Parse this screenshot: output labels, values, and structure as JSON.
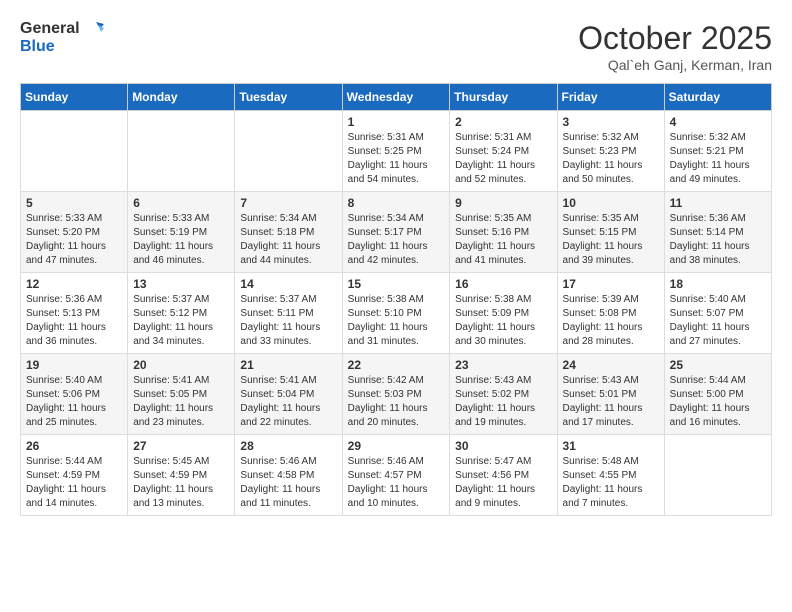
{
  "logo": {
    "general": "General",
    "blue": "Blue"
  },
  "header": {
    "month_year": "October 2025",
    "location": "Qal`eh Ganj, Kerman, Iran"
  },
  "weekdays": [
    "Sunday",
    "Monday",
    "Tuesday",
    "Wednesday",
    "Thursday",
    "Friday",
    "Saturday"
  ],
  "weeks": [
    [
      {
        "day": "",
        "detail": ""
      },
      {
        "day": "",
        "detail": ""
      },
      {
        "day": "",
        "detail": ""
      },
      {
        "day": "1",
        "detail": "Sunrise: 5:31 AM\nSunset: 5:25 PM\nDaylight: 11 hours\nand 54 minutes."
      },
      {
        "day": "2",
        "detail": "Sunrise: 5:31 AM\nSunset: 5:24 PM\nDaylight: 11 hours\nand 52 minutes."
      },
      {
        "day": "3",
        "detail": "Sunrise: 5:32 AM\nSunset: 5:23 PM\nDaylight: 11 hours\nand 50 minutes."
      },
      {
        "day": "4",
        "detail": "Sunrise: 5:32 AM\nSunset: 5:21 PM\nDaylight: 11 hours\nand 49 minutes."
      }
    ],
    [
      {
        "day": "5",
        "detail": "Sunrise: 5:33 AM\nSunset: 5:20 PM\nDaylight: 11 hours\nand 47 minutes."
      },
      {
        "day": "6",
        "detail": "Sunrise: 5:33 AM\nSunset: 5:19 PM\nDaylight: 11 hours\nand 46 minutes."
      },
      {
        "day": "7",
        "detail": "Sunrise: 5:34 AM\nSunset: 5:18 PM\nDaylight: 11 hours\nand 44 minutes."
      },
      {
        "day": "8",
        "detail": "Sunrise: 5:34 AM\nSunset: 5:17 PM\nDaylight: 11 hours\nand 42 minutes."
      },
      {
        "day": "9",
        "detail": "Sunrise: 5:35 AM\nSunset: 5:16 PM\nDaylight: 11 hours\nand 41 minutes."
      },
      {
        "day": "10",
        "detail": "Sunrise: 5:35 AM\nSunset: 5:15 PM\nDaylight: 11 hours\nand 39 minutes."
      },
      {
        "day": "11",
        "detail": "Sunrise: 5:36 AM\nSunset: 5:14 PM\nDaylight: 11 hours\nand 38 minutes."
      }
    ],
    [
      {
        "day": "12",
        "detail": "Sunrise: 5:36 AM\nSunset: 5:13 PM\nDaylight: 11 hours\nand 36 minutes."
      },
      {
        "day": "13",
        "detail": "Sunrise: 5:37 AM\nSunset: 5:12 PM\nDaylight: 11 hours\nand 34 minutes."
      },
      {
        "day": "14",
        "detail": "Sunrise: 5:37 AM\nSunset: 5:11 PM\nDaylight: 11 hours\nand 33 minutes."
      },
      {
        "day": "15",
        "detail": "Sunrise: 5:38 AM\nSunset: 5:10 PM\nDaylight: 11 hours\nand 31 minutes."
      },
      {
        "day": "16",
        "detail": "Sunrise: 5:38 AM\nSunset: 5:09 PM\nDaylight: 11 hours\nand 30 minutes."
      },
      {
        "day": "17",
        "detail": "Sunrise: 5:39 AM\nSunset: 5:08 PM\nDaylight: 11 hours\nand 28 minutes."
      },
      {
        "day": "18",
        "detail": "Sunrise: 5:40 AM\nSunset: 5:07 PM\nDaylight: 11 hours\nand 27 minutes."
      }
    ],
    [
      {
        "day": "19",
        "detail": "Sunrise: 5:40 AM\nSunset: 5:06 PM\nDaylight: 11 hours\nand 25 minutes."
      },
      {
        "day": "20",
        "detail": "Sunrise: 5:41 AM\nSunset: 5:05 PM\nDaylight: 11 hours\nand 23 minutes."
      },
      {
        "day": "21",
        "detail": "Sunrise: 5:41 AM\nSunset: 5:04 PM\nDaylight: 11 hours\nand 22 minutes."
      },
      {
        "day": "22",
        "detail": "Sunrise: 5:42 AM\nSunset: 5:03 PM\nDaylight: 11 hours\nand 20 minutes."
      },
      {
        "day": "23",
        "detail": "Sunrise: 5:43 AM\nSunset: 5:02 PM\nDaylight: 11 hours\nand 19 minutes."
      },
      {
        "day": "24",
        "detail": "Sunrise: 5:43 AM\nSunset: 5:01 PM\nDaylight: 11 hours\nand 17 minutes."
      },
      {
        "day": "25",
        "detail": "Sunrise: 5:44 AM\nSunset: 5:00 PM\nDaylight: 11 hours\nand 16 minutes."
      }
    ],
    [
      {
        "day": "26",
        "detail": "Sunrise: 5:44 AM\nSunset: 4:59 PM\nDaylight: 11 hours\nand 14 minutes."
      },
      {
        "day": "27",
        "detail": "Sunrise: 5:45 AM\nSunset: 4:59 PM\nDaylight: 11 hours\nand 13 minutes."
      },
      {
        "day": "28",
        "detail": "Sunrise: 5:46 AM\nSunset: 4:58 PM\nDaylight: 11 hours\nand 11 minutes."
      },
      {
        "day": "29",
        "detail": "Sunrise: 5:46 AM\nSunset: 4:57 PM\nDaylight: 11 hours\nand 10 minutes."
      },
      {
        "day": "30",
        "detail": "Sunrise: 5:47 AM\nSunset: 4:56 PM\nDaylight: 11 hours\nand 9 minutes."
      },
      {
        "day": "31",
        "detail": "Sunrise: 5:48 AM\nSunset: 4:55 PM\nDaylight: 11 hours\nand 7 minutes."
      },
      {
        "day": "",
        "detail": ""
      }
    ]
  ]
}
